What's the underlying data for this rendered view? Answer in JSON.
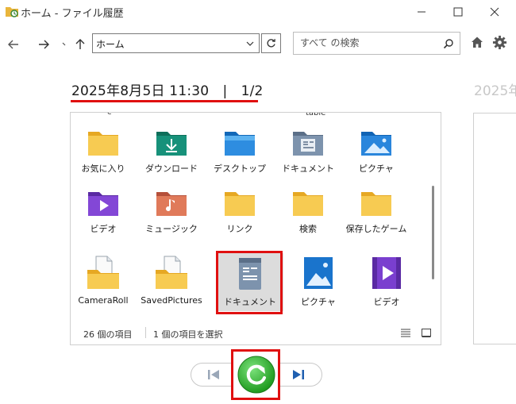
{
  "window": {
    "title": "ホーム - ファイル履歴",
    "minimize_icon": "minimize-icon",
    "maximize_icon": "maximize-icon",
    "close_icon": "close-icon"
  },
  "nav": {
    "address": "ホーム",
    "search_placeholder": "すべて の検索"
  },
  "header": {
    "title": "2025年8月5日 11:30　|　1/2",
    "next_title": "2025年"
  },
  "folders": {
    "partial_top_right": "table",
    "items": [
      {
        "label": "お気に入り",
        "icon": "folder-icon"
      },
      {
        "label": "ダウンロード",
        "icon": "downloads-folder-icon"
      },
      {
        "label": "デスクトップ",
        "icon": "desktop-folder-icon"
      },
      {
        "label": "ドキュメント",
        "icon": "documents-folder-icon"
      },
      {
        "label": "ピクチャ",
        "icon": "pictures-folder-icon"
      },
      {
        "label": "ビデオ",
        "icon": "videos-folder-icon"
      },
      {
        "label": "ミュージック",
        "icon": "music-folder-icon"
      },
      {
        "label": "リンク",
        "icon": "folder-icon"
      },
      {
        "label": "検索",
        "icon": "folder-icon"
      },
      {
        "label": "保存したゲーム",
        "icon": "folder-icon"
      },
      {
        "label": "CameraRoll",
        "icon": "folder-with-document-icon"
      },
      {
        "label": "SavedPictures",
        "icon": "folder-with-document-icon"
      },
      {
        "label": "ドキュメント",
        "icon": "documents-library-icon"
      },
      {
        "label": "ピクチャ",
        "icon": "pictures-library-icon"
      },
      {
        "label": "ビデオ",
        "icon": "videos-library-icon"
      }
    ]
  },
  "status": {
    "item_count": "26 個の項目",
    "selected": "1 個の項目を選択"
  },
  "colors": {
    "highlight": "#e01010",
    "folder_yellow": "#f5c545",
    "reload_green": "#2aa52a",
    "pager_blue": "#1f5fb0"
  }
}
